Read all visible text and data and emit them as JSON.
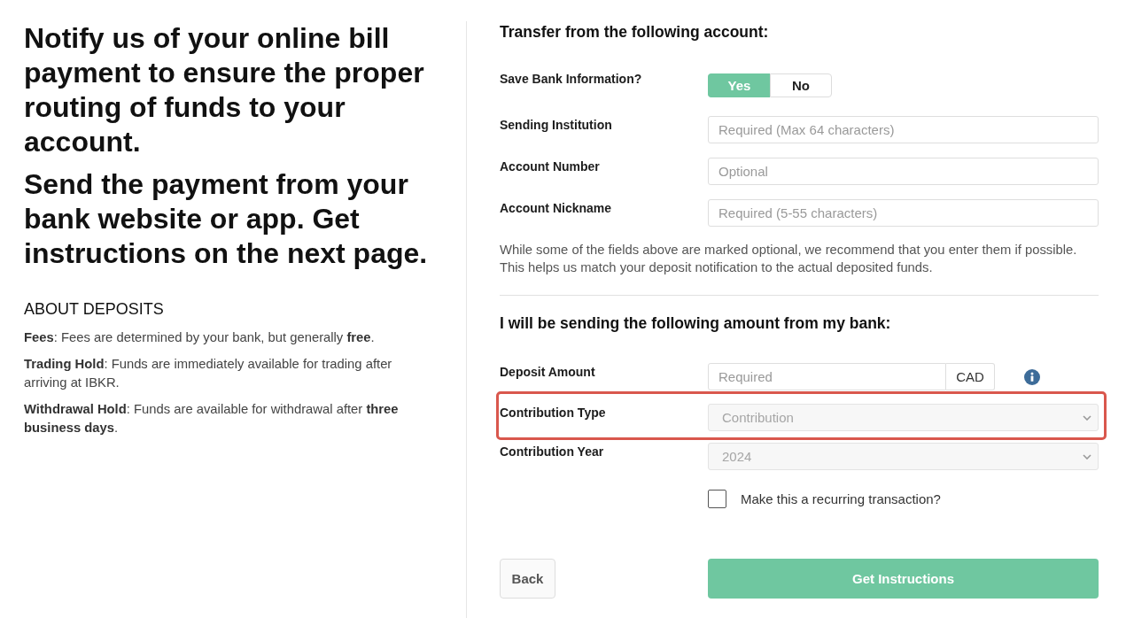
{
  "intro": {
    "headings": [
      "Notify us of your online bill payment to ensure the proper routing of funds to your account.",
      "Send the payment from your bank website or app. Get instructions on the next page."
    ],
    "about": {
      "title": "ABOUT DEPOSITS",
      "items": [
        "**Fees**: Fees are determined by your bank, but generally **free**.",
        "**Trading Hold**: Funds are immediately available for trading after arriving at IBKR.",
        "**Withdrawal Hold**: Funds are available for withdrawal after **three business days**."
      ]
    }
  },
  "transfer": {
    "title": "Transfer from the following account:",
    "rows": [
      {
        "kind": "toggle",
        "label": "Save Bank Information?",
        "options": [
          {
            "label": "Yes",
            "selected": true
          },
          {
            "label": "No",
            "selected": false
          }
        ]
      },
      {
        "kind": "text",
        "label": "Sending Institution",
        "placeholder": "Required (Max 64 characters)"
      },
      {
        "kind": "text",
        "label": "Account Number",
        "placeholder": "Optional"
      },
      {
        "kind": "text",
        "label": "Account Nickname",
        "placeholder": "Required (5-55 characters)"
      }
    ],
    "note": "While some of the fields above are marked optional, we recommend that you enter them if possible. This helps us match your deposit notification to the actual deposited funds."
  },
  "amount": {
    "title": "I will be sending the following amount from my bank:",
    "rows": [
      {
        "kind": "amount",
        "label": "Deposit Amount",
        "placeholder": "Required",
        "currency": "CAD",
        "highlighted": false
      },
      {
        "kind": "select",
        "label": "Contribution Type",
        "value": "Contribution",
        "disabled": true,
        "highlighted": true
      },
      {
        "kind": "select",
        "label": "Contribution Year",
        "value": "2024",
        "disabled": true,
        "highlighted": false
      }
    ],
    "recurring": {
      "label": "Make this a recurring transaction?",
      "checked": false
    }
  },
  "actions": [
    {
      "kind": "back",
      "label": "Back"
    },
    {
      "kind": "submit",
      "label": "Get Instructions"
    }
  ]
}
